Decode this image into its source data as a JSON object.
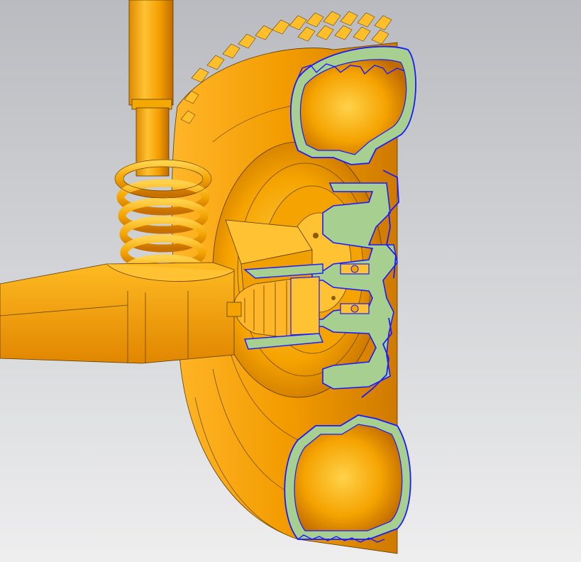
{
  "view": {
    "background_top": "#b9bbc0",
    "background_bottom": "#eeeeef",
    "part_color": "#f3a400",
    "part_highlight": "#ffd24a",
    "part_shadow": "#c77000",
    "section_fill": "#a7cf8f",
    "section_edge": "#1a1aff",
    "edge_line": "#3a2a00"
  },
  "components": [
    "strut-tube",
    "coil-spring",
    "control-arm",
    "tire",
    "wheel-rim",
    "hub",
    "cv-joint-boot",
    "drive-shaft",
    "bearing"
  ]
}
